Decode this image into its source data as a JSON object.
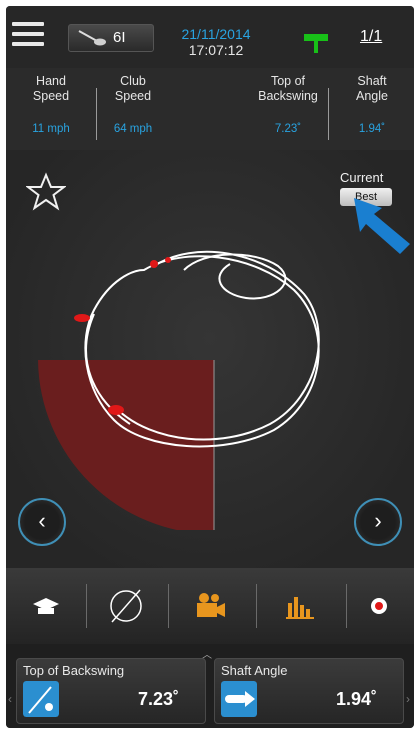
{
  "header": {
    "club": "6I",
    "date": "21/11/2014",
    "time": "17:07:12",
    "page": "1/1"
  },
  "stats": [
    {
      "label_line1": "Hand",
      "label_line2": "Speed",
      "value": "11 mph"
    },
    {
      "label_line1": "Club",
      "label_line2": "Speed",
      "value": "64 mph"
    },
    {
      "label_line1": "Top of",
      "label_line2": "Backswing",
      "value": "7.23˚"
    },
    {
      "label_line1": "Shaft",
      "label_line2": "Angle",
      "value": "1.94˚"
    }
  ],
  "panel": {
    "current_label": "Current",
    "best_label": "Best"
  },
  "nav": {
    "prev": "‹",
    "next": "›"
  },
  "toolbar": {
    "icons": [
      "graduation-cap-icon",
      "swing-path-icon",
      "video-camera-icon",
      "bar-chart-icon",
      "record-icon"
    ]
  },
  "bottom_metrics": [
    {
      "label": "Top of Backswing",
      "value": "7.23˚"
    },
    {
      "label": "Shaft Angle",
      "value": "1.94˚"
    }
  ],
  "colors": {
    "accent_blue": "#29a3e0",
    "flag_green": "#18c018",
    "toolbar_orange": "#e8961e",
    "zone_red": "#6e1e1e",
    "marker_red": "#e01818"
  }
}
